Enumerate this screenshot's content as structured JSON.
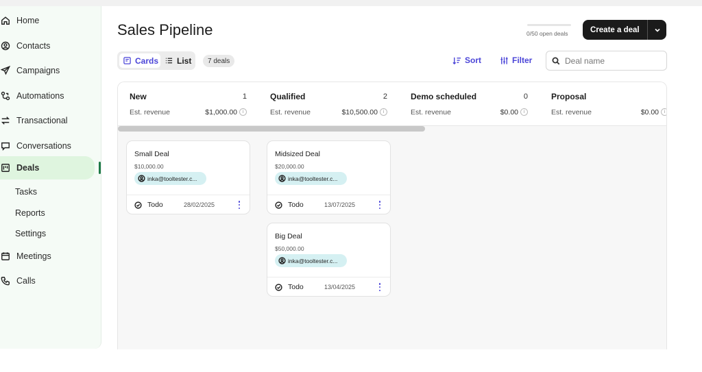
{
  "sidebar": {
    "items": [
      {
        "label": "Home",
        "icon": "home-icon"
      },
      {
        "label": "Contacts",
        "icon": "contacts-icon"
      },
      {
        "label": "Campaigns",
        "icon": "send-icon"
      },
      {
        "label": "Automations",
        "icon": "automation-icon"
      },
      {
        "label": "Transactional",
        "icon": "transfer-icon"
      },
      {
        "label": "Conversations",
        "icon": "chat-icon"
      },
      {
        "label": "Deals",
        "icon": "deals-icon",
        "active": true
      }
    ],
    "sub_items": [
      "Tasks",
      "Reports",
      "Settings"
    ],
    "bottom_items": [
      {
        "label": "Meetings",
        "icon": "calendar-icon"
      },
      {
        "label": "Calls",
        "icon": "phone-icon"
      }
    ]
  },
  "header": {
    "title": "Sales Pipeline",
    "open_deals": "0/50 open deals",
    "create_label": "Create a deal"
  },
  "toolbar": {
    "cards_label": "Cards",
    "list_label": "List",
    "deal_count": "7 deals",
    "sort_label": "Sort",
    "filter_label": "Filter",
    "search_placeholder": "Deal name"
  },
  "board": {
    "revenue_label": "Est. revenue",
    "columns": [
      {
        "title": "New",
        "count": "1",
        "revenue": "$1,000.00",
        "cards": [
          {
            "title": "Small Deal",
            "amount": "$10,000.00",
            "contact": "inka@tooltester.c...",
            "status": "Todo",
            "date": "28/02/2025"
          }
        ]
      },
      {
        "title": "Qualified",
        "count": "2",
        "revenue": "$10,500.00",
        "cards": [
          {
            "title": "Midsized Deal",
            "amount": "$20,000.00",
            "contact": "inka@tooltester.c...",
            "status": "Todo",
            "date": "13/07/2025"
          },
          {
            "title": "Big Deal",
            "amount": "$50,000.00",
            "contact": "inka@tooltester.c...",
            "status": "Todo",
            "date": "13/04/2025"
          }
        ]
      },
      {
        "title": "Demo scheduled",
        "count": "0",
        "revenue": "$0.00",
        "cards": []
      },
      {
        "title": "Proposal",
        "count": "0",
        "revenue": "$0.00",
        "cards": []
      }
    ]
  },
  "colors": {
    "accent": "#4b45d8",
    "active_bg": "#dff5df",
    "sidebar_bg": "#f5fbf6",
    "chip_bg": "#d5f0f2",
    "primary_btn": "#1b1b1b"
  }
}
